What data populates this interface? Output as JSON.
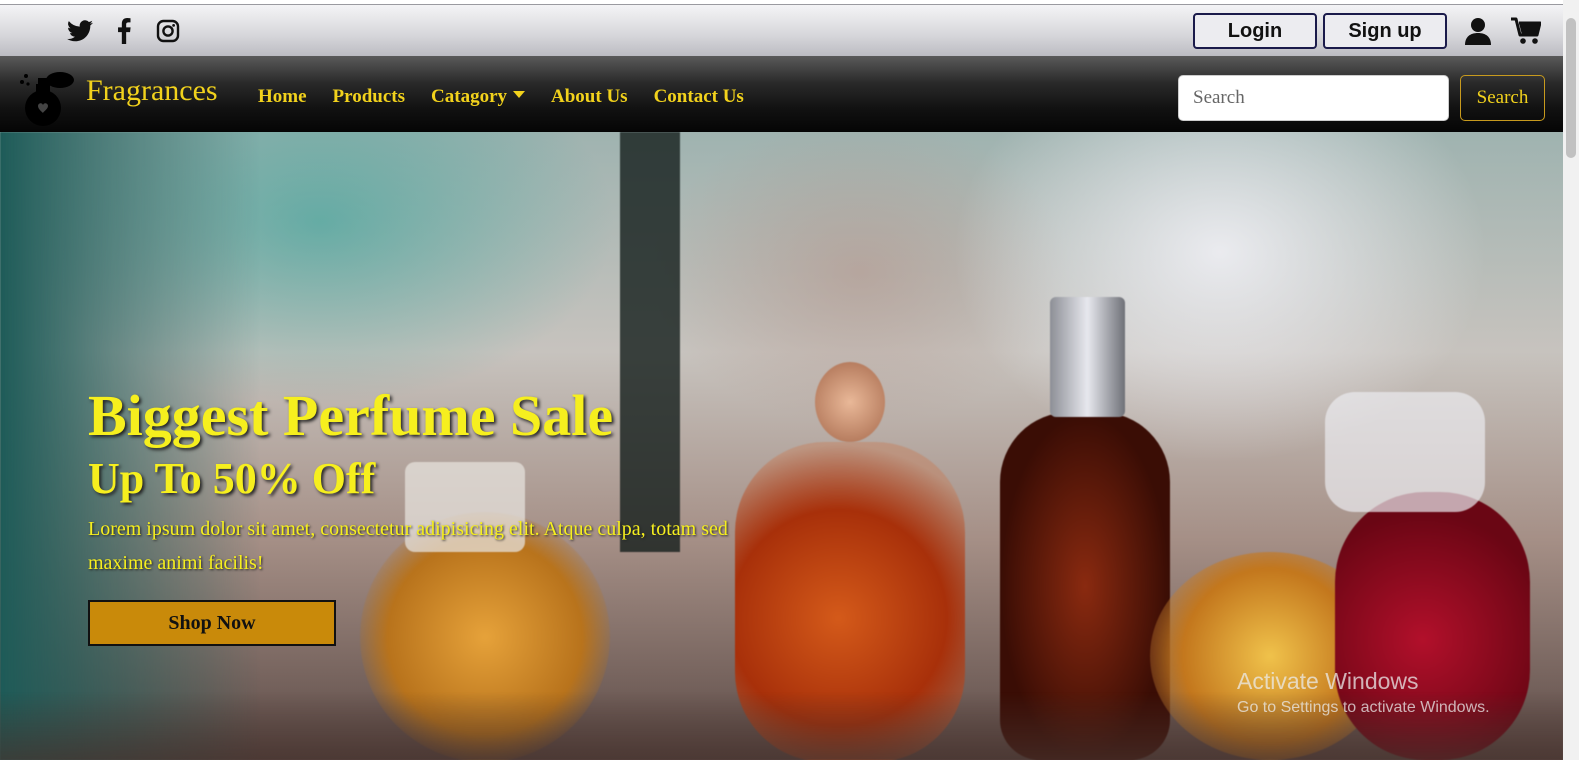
{
  "topbar": {
    "social": [
      {
        "name": "twitter-icon"
      },
      {
        "name": "facebook-icon"
      },
      {
        "name": "instagram-icon"
      }
    ],
    "login_label": "Login",
    "signup_label": "Sign up"
  },
  "navbar": {
    "brand": "Fragrances",
    "links": [
      "Home",
      "Products",
      "Catagory",
      "About Us",
      "Contact Us"
    ],
    "search_placeholder": "Search",
    "search_button": "Search"
  },
  "hero": {
    "title": "Biggest Perfume Sale",
    "subtitle": "Up To 50% Off",
    "description": "Lorem ipsum dolor sit amet, consectetur adipisicing elit. Atque culpa, totam sed maxime animi facilis!",
    "cta": "Shop Now"
  },
  "watermark": {
    "title": "Activate Windows",
    "subtitle": "Go to Settings to activate Windows."
  },
  "colors": {
    "accent_yellow": "#f2d21c",
    "cta_gold": "#c98a0a"
  }
}
